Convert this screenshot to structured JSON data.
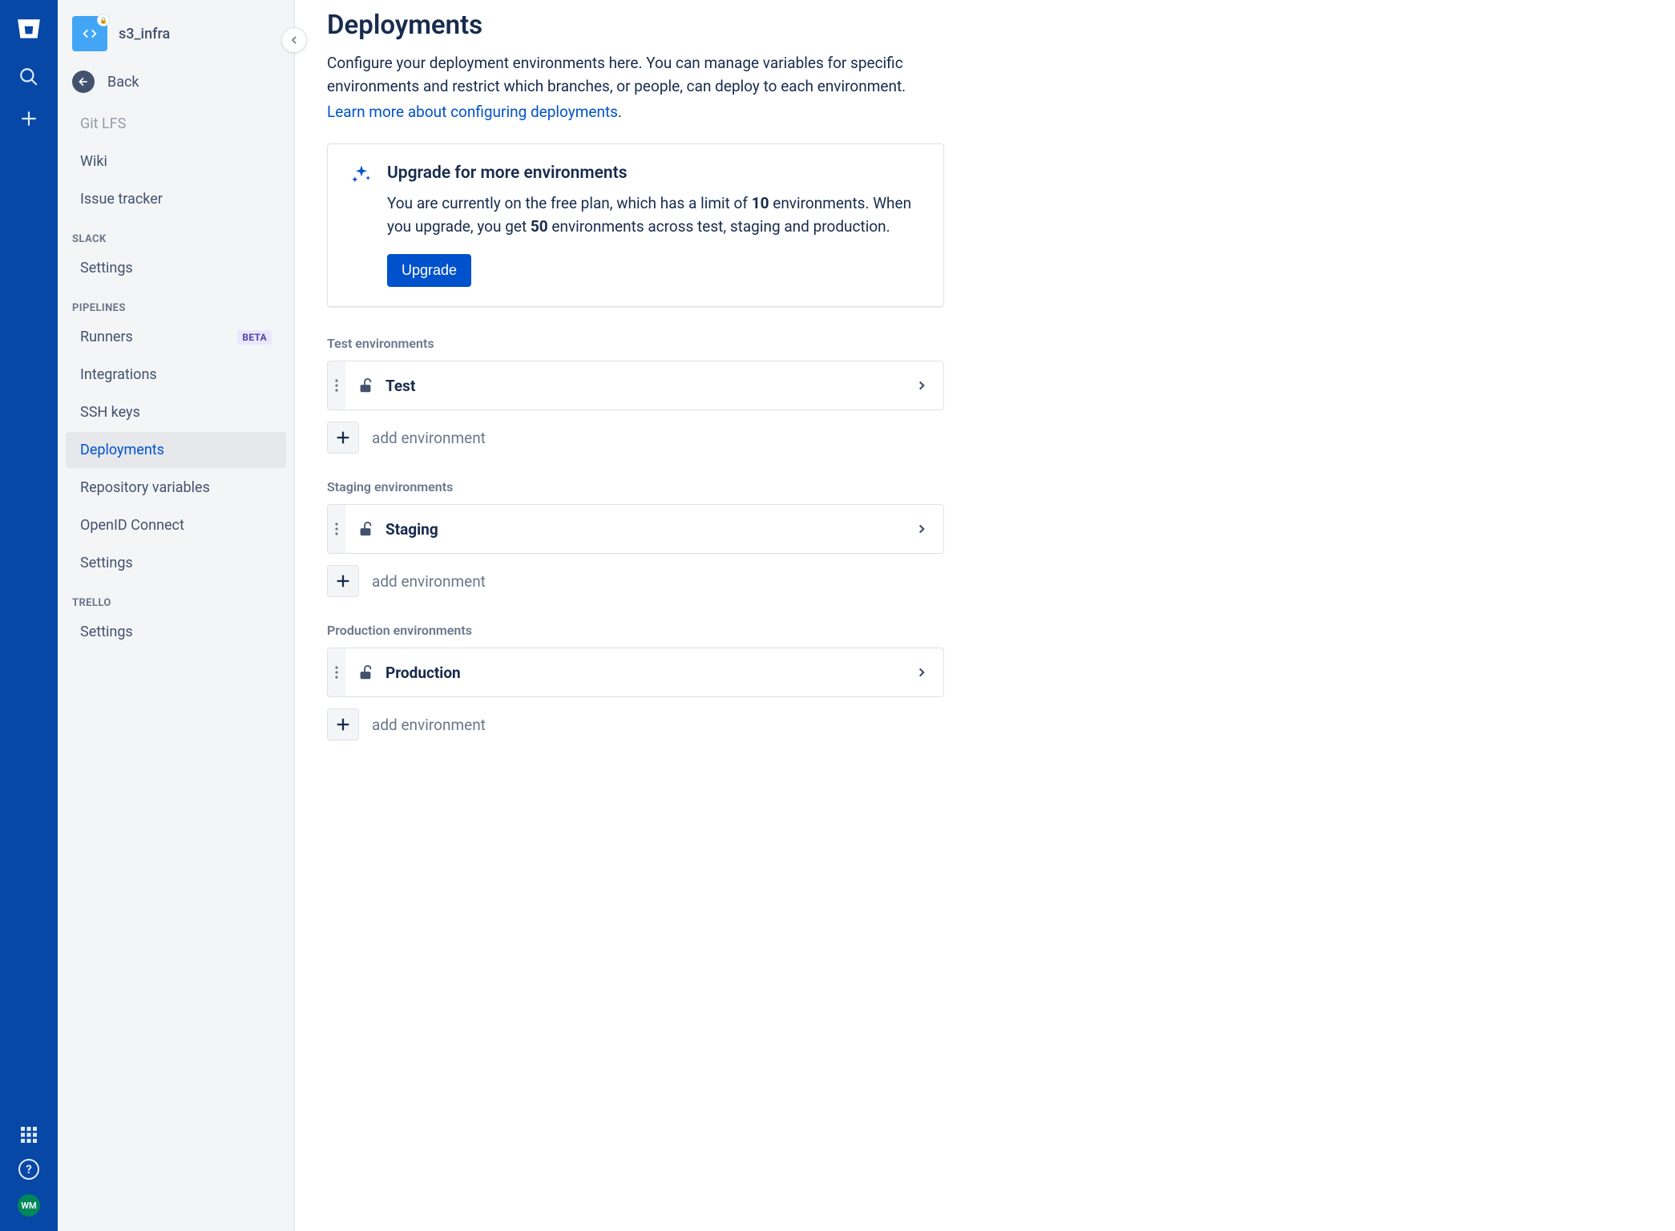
{
  "rail": {
    "avatar_initials": "WM"
  },
  "sidebar": {
    "repo_name": "s3_infra",
    "back_label": "Back",
    "top_items": [
      {
        "label": "Git LFS"
      },
      {
        "label": "Wiki"
      },
      {
        "label": "Issue tracker"
      }
    ],
    "sections": [
      {
        "title": "SLACK",
        "items": [
          {
            "label": "Settings",
            "active": false
          }
        ]
      },
      {
        "title": "PIPELINES",
        "items": [
          {
            "label": "Runners",
            "active": false,
            "badge": "BETA"
          },
          {
            "label": "Integrations",
            "active": false
          },
          {
            "label": "SSH keys",
            "active": false
          },
          {
            "label": "Deployments",
            "active": true
          },
          {
            "label": "Repository variables",
            "active": false
          },
          {
            "label": "OpenID Connect",
            "active": false
          },
          {
            "label": "Settings",
            "active": false
          }
        ]
      },
      {
        "title": "TRELLO",
        "items": [
          {
            "label": "Settings",
            "active": false
          }
        ]
      }
    ]
  },
  "main": {
    "title": "Deployments",
    "description": "Configure your deployment environments here. You can manage variables for specific environments and restrict which branches, or people, can deploy to each environment.",
    "learn_link": "Learn more about configuring deployments",
    "upgrade": {
      "title": "Upgrade for more environments",
      "text_pre": "You are currently on the free plan, which has a limit of ",
      "limit_free": "10",
      "text_mid": " environments. When you upgrade, you get ",
      "limit_paid": "50",
      "text_post": " environments across test, staging and production.",
      "button": "Upgrade"
    },
    "env_groups": [
      {
        "title": "Test environments",
        "env_name": "Test",
        "add_label": "add environment"
      },
      {
        "title": "Staging environments",
        "env_name": "Staging",
        "add_label": "add environment"
      },
      {
        "title": "Production environments",
        "env_name": "Production",
        "add_label": "add environment"
      }
    ]
  }
}
